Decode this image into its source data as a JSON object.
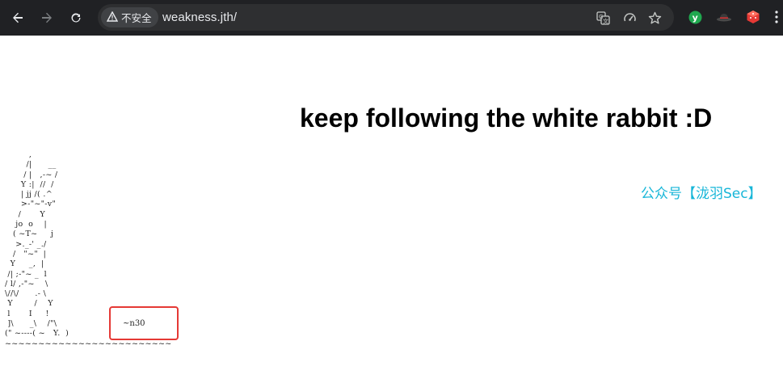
{
  "browser": {
    "security_label": "不安全",
    "url": "weakness.jth/",
    "icons": {
      "back": "back-arrow-icon",
      "forward": "forward-arrow-icon",
      "reload": "reload-icon",
      "warning": "warning-triangle-icon",
      "translate": "translate-icon",
      "performance": "gauge-icon",
      "bookmark": "star-icon",
      "extension_1": "green-y-extension-icon",
      "extension_2": "hat-extension-icon",
      "extension_3": "red-cube-extension-icon",
      "menu": "more-vert-icon"
    }
  },
  "page": {
    "heading": "keep following the white rabbit :D",
    "wechat_link": "公众号【泷羽Sec】",
    "ascii_art": "         ,\n        /|      __\n       / |   ,-~ /\n      Y :|  //  /\n      | jj /( .^\n      >-\"~\"-v\"\n     /       Y\n    jo  o    |\n   ( ~T~     j\n    >._-' _./\n   /   \"~\"  |\n  Y     _,  |\n /| ;-\"~ _  l\n/ l/ ,-\"~    \\\n\\//\\/      .- \\\n Y        /    Y\n l       I     !\n ]\\      _\\    /\"\\\n(\" ~----( ~   Y.  )\n~~~~~~~~~~~~~~~~~~~~~~~~~",
    "hidden_code": "~n30"
  },
  "colors": {
    "toolbar_bg": "#202124",
    "omnibox_bg": "#2e2f31",
    "link_color": "#17b6d8",
    "highlight_border": "#e53935"
  }
}
